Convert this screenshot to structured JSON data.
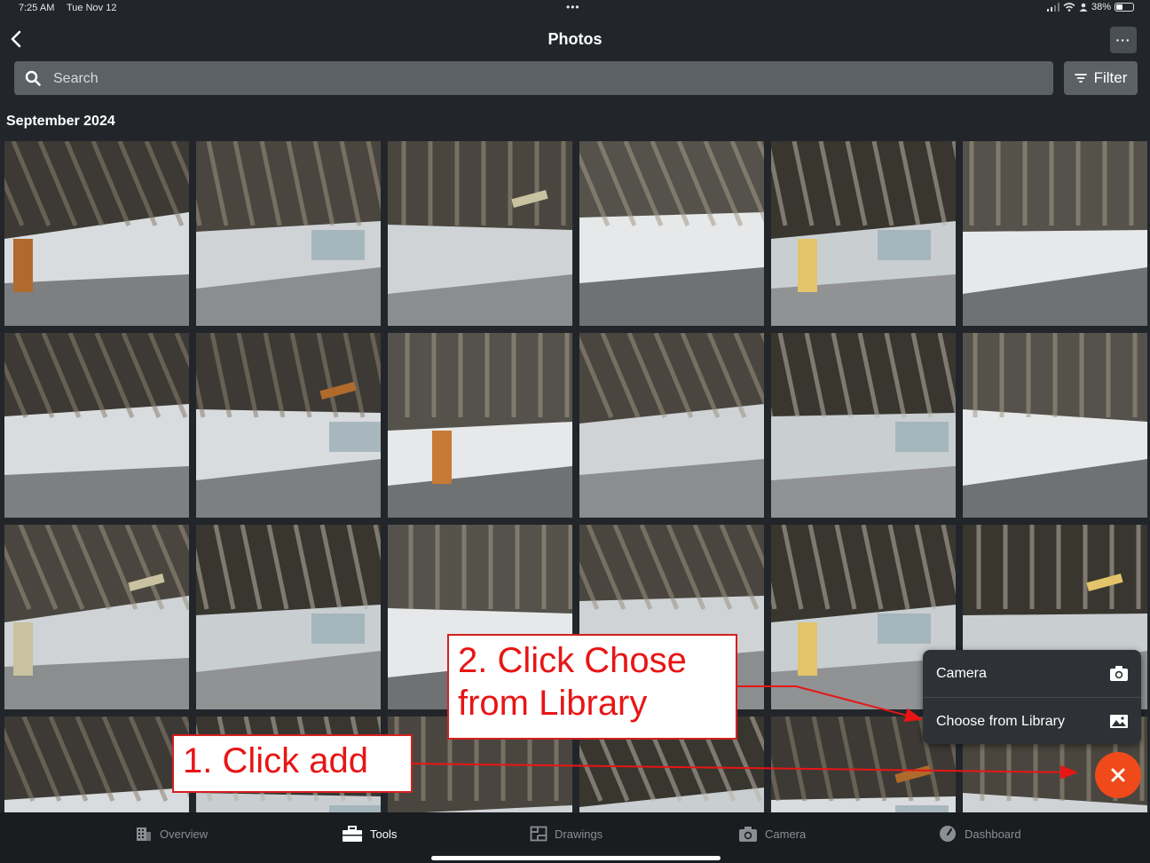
{
  "status_bar": {
    "time": "7:25 AM",
    "date": "Tue Nov 12",
    "battery": "38%",
    "battery_fraction": 0.38
  },
  "header": {
    "title": "Photos"
  },
  "search": {
    "placeholder": "Search"
  },
  "filter": {
    "label": "Filter"
  },
  "section": {
    "title": "September 2024"
  },
  "photos": [
    {
      "palette": "a"
    },
    {
      "palette": "b"
    },
    {
      "palette": "b"
    },
    {
      "palette": "c"
    },
    {
      "palette": "d"
    },
    {
      "palette": "c"
    },
    {
      "palette": "a"
    },
    {
      "palette": "a"
    },
    {
      "palette": "c"
    },
    {
      "palette": "b"
    },
    {
      "palette": "d"
    },
    {
      "palette": "c"
    },
    {
      "palette": "b"
    },
    {
      "palette": "d"
    },
    {
      "palette": "c"
    },
    {
      "palette": "b"
    },
    {
      "palette": "d"
    },
    {
      "palette": "d"
    },
    {
      "palette": "a"
    },
    {
      "palette": "d"
    },
    {
      "palette": "b"
    },
    {
      "palette": "d"
    },
    {
      "palette": "a"
    },
    {
      "palette": "b"
    }
  ],
  "popup_menu": {
    "items": [
      {
        "label": "Camera",
        "icon": "camera-icon"
      },
      {
        "label": "Choose from Library",
        "icon": "image-icon"
      }
    ]
  },
  "fab": {
    "icon": "close-icon"
  },
  "annotations": {
    "step1": "1. Click add",
    "step2_line1": "2. Click Chose",
    "step2_line2": "from Library",
    "color": "#e81515"
  },
  "tabs": [
    {
      "label": "Overview",
      "icon": "building-icon",
      "active": false
    },
    {
      "label": "Tools",
      "icon": "toolbox-icon",
      "active": true
    },
    {
      "label": "Drawings",
      "icon": "blueprint-icon",
      "active": false
    },
    {
      "label": "Camera",
      "icon": "camera-icon",
      "active": false
    },
    {
      "label": "Dashboard",
      "icon": "gauge-icon",
      "active": false
    }
  ]
}
